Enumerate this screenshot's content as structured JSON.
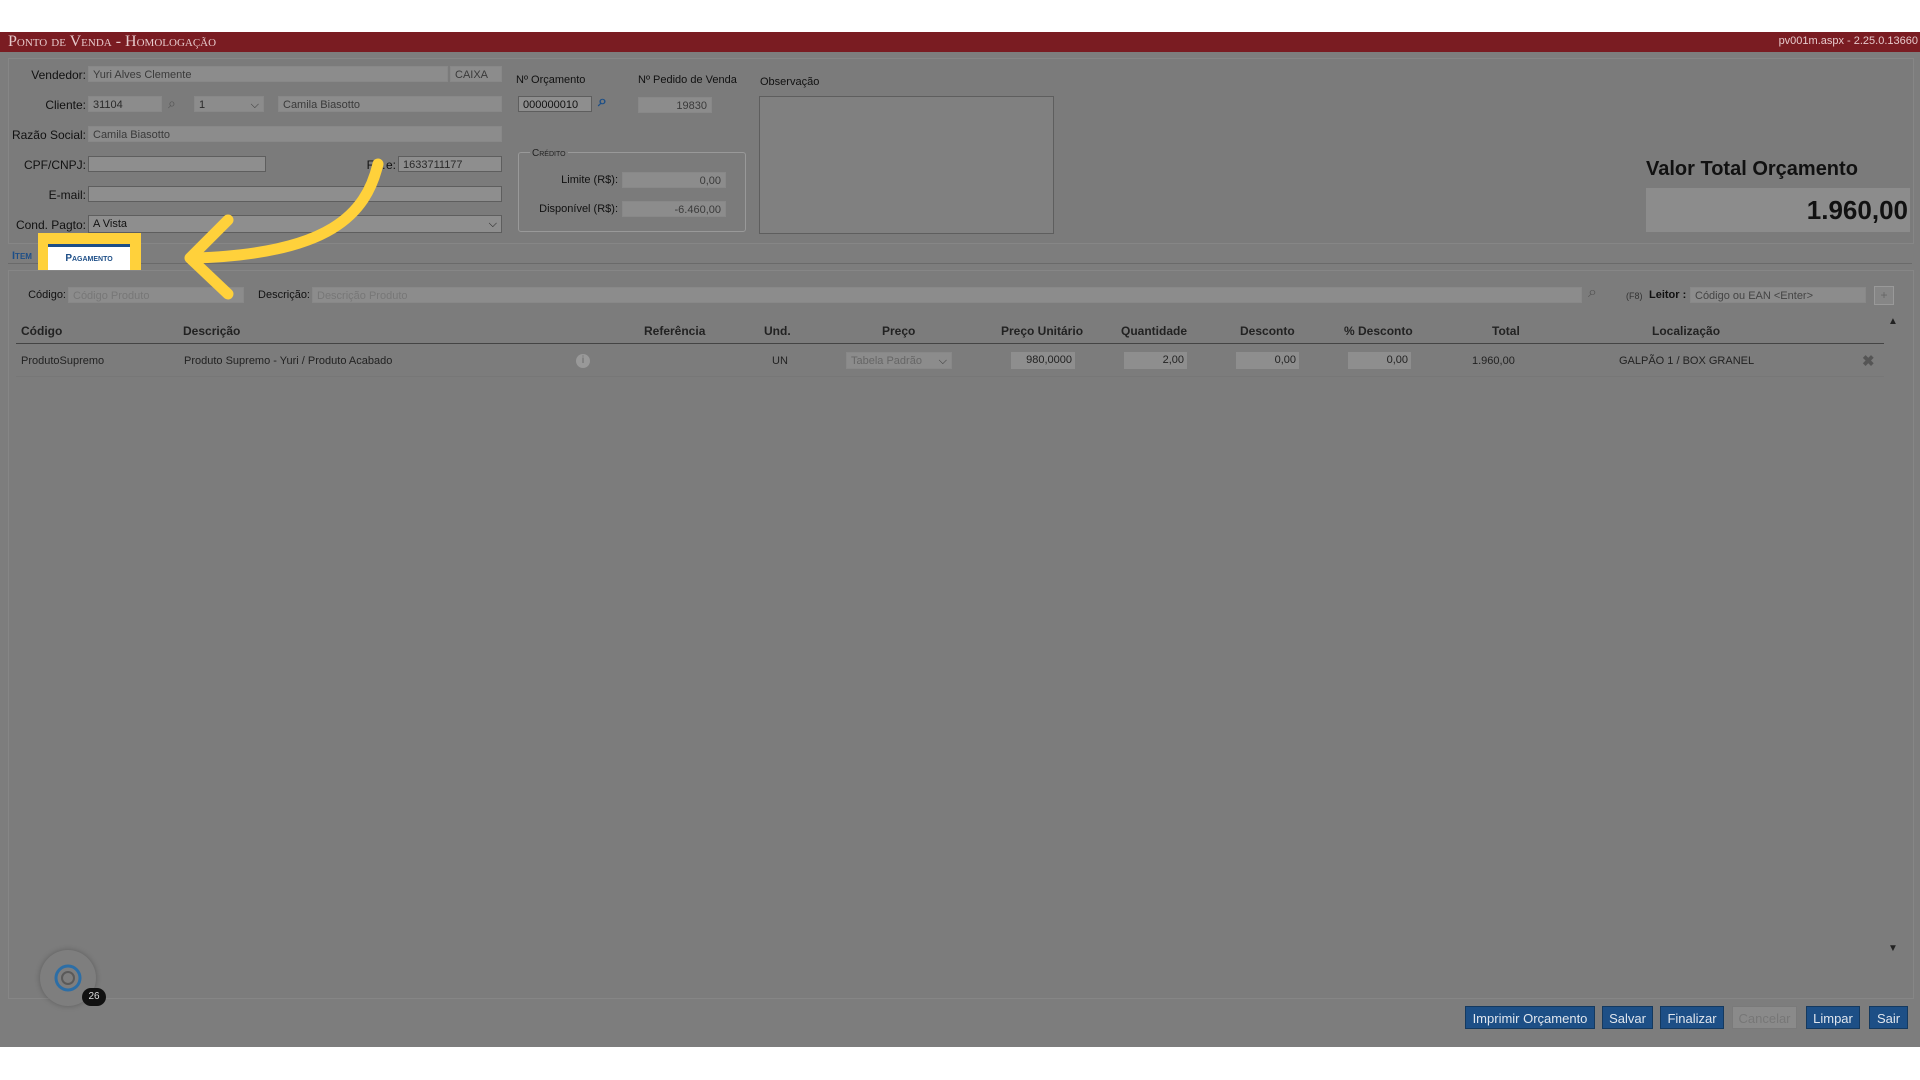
{
  "titlebar": {
    "title": "Ponto de Venda  - Homologação",
    "version": "pv001m.aspx - 2.25.0.13660"
  },
  "form": {
    "vendedor_label": "Vendedor:",
    "vendedor_value": "Yuri Alves Clemente",
    "caixa_value": "CAIXA",
    "cliente_label": "Cliente:",
    "cliente_code": "31104",
    "cliente_seq": "1",
    "cliente_name": "Camila Biasotto",
    "razao_label": "Razão Social:",
    "razao_value": "Camila Biasotto",
    "cpf_label": "CPF/CNPJ:",
    "cpf_value": "",
    "fone_label": "F…e:",
    "fone_value": "1633711177",
    "email_label": "E-mail:",
    "email_value": "",
    "cond_label": "Cond. Pagto:",
    "cond_value": "A Vista"
  },
  "orcamento": {
    "label": "Nº Orçamento",
    "value": "000000010"
  },
  "pedido": {
    "label": "Nº Pedido de Venda",
    "value": "19830"
  },
  "credito": {
    "title": "Crédito",
    "limite_label": "Limite (R$):",
    "limite_value": "0,00",
    "disponivel_label": "Disponível (R$):",
    "disponivel_value": "-6.460,00"
  },
  "observacao": {
    "label": "Observação",
    "value": ""
  },
  "total": {
    "label": "Valor Total Orçamento",
    "value": "1.960,00"
  },
  "tabs": {
    "itens": "Item",
    "pagamento": "Pagamento"
  },
  "search": {
    "codigo_label": "Código:",
    "codigo_placeholder": "Código Produto",
    "descricao_label": "Descrição:",
    "descricao_placeholder": "Descrição Produto",
    "f8": "(F8)",
    "leitor_label": "Leitor :",
    "leitor_placeholder": "Código ou EAN <Enter>"
  },
  "table": {
    "headers": [
      "Código",
      "Descrição",
      "Referência",
      "Und.",
      "Preço",
      "Preço Unitário",
      "Quantidade",
      "Desconto",
      "% Desconto",
      "Total",
      "Localização"
    ],
    "rows": [
      {
        "codigo": "ProdutoSupremo",
        "descricao": "Produto Supremo - Yuri / Produto Acabado",
        "referencia": "",
        "und": "UN",
        "preco": "Tabela Padrão",
        "preco_unitario": "980,0000",
        "quantidade": "2,00",
        "desconto": "0,00",
        "pct_desconto": "0,00",
        "total": "1.960,00",
        "localizacao": "GALPÃO 1 / BOX GRANEL"
      }
    ]
  },
  "buttons": {
    "imprimir": "Imprimir Orçamento",
    "salvar": "Salvar",
    "finalizar": "Finalizar",
    "cancelar": "Cancelar",
    "limpar": "Limpar",
    "sair": "Sair"
  },
  "widget": {
    "badge": "26"
  },
  "colors": {
    "header_bg": "#7a1c22",
    "button_bg": "#1d4f86",
    "highlight": "#ffd13b",
    "overlay_gray": "#7d7d7d"
  }
}
